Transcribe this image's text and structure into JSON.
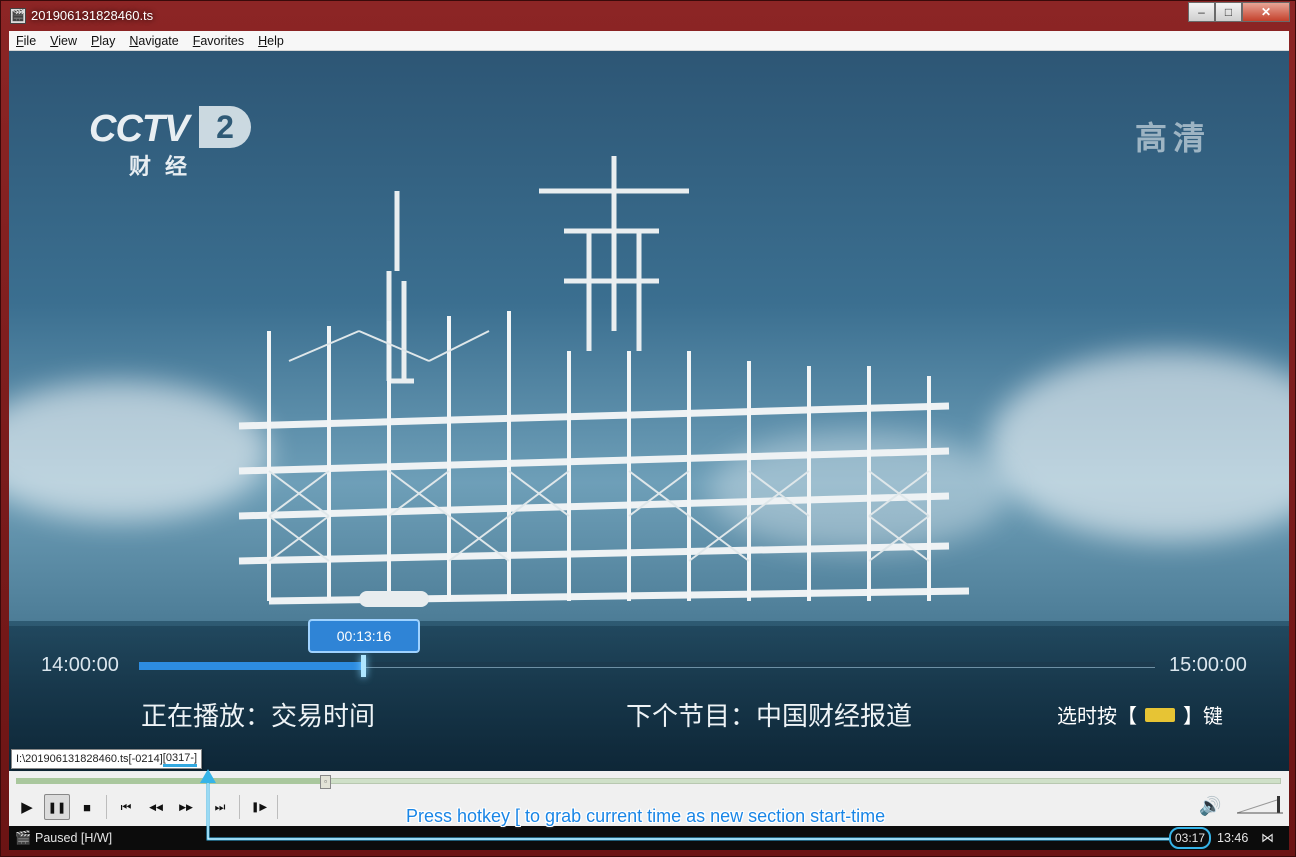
{
  "window": {
    "title": "201906131828460.ts",
    "min_glyph": "–",
    "max_glyph": "□",
    "close_glyph": "✕"
  },
  "menu": [
    {
      "u": "F",
      "rest": "ile"
    },
    {
      "u": "V",
      "rest": "iew"
    },
    {
      "u": "P",
      "rest": "lay"
    },
    {
      "u": "N",
      "rest": "avigate"
    },
    {
      "u": "F",
      "rest": "avorites"
    },
    {
      "u": "H",
      "rest": "elp"
    }
  ],
  "video": {
    "logo_main": "CCTV",
    "logo_channel": "2",
    "logo_sub": "财经",
    "hd_badge": "高清",
    "osd": {
      "tooltip_time": "00:13:16",
      "start_time": "14:00:00",
      "end_time": "15:00:00",
      "progress": 0.22,
      "now_playing": "正在播放：交易时间",
      "next_program": "下个节目：中国财经报道",
      "hint_left": "选时按【",
      "hint_right": "】键"
    }
  },
  "player": {
    "seek_position": 0.245,
    "filename_tip_main": "I:\\201906131828460.ts[-0214]",
    "filename_tip_highlight": "[0317-]",
    "status": "Paused [H/W]",
    "time_current": "03:17",
    "time_total": "13:46",
    "annotation": "Press hotkey [ to grab current time as new section start-time",
    "accent": "#36b4e8"
  },
  "icons": {
    "play": "▶",
    "pause": "❚❚",
    "stop": "■",
    "prev": "⏮",
    "rewind": "◀◀",
    "forward": "▶▶",
    "next": "⏭",
    "frame_step": "❚▶",
    "volume": "🔊",
    "clapper": "🎬",
    "signal": "⋈"
  }
}
